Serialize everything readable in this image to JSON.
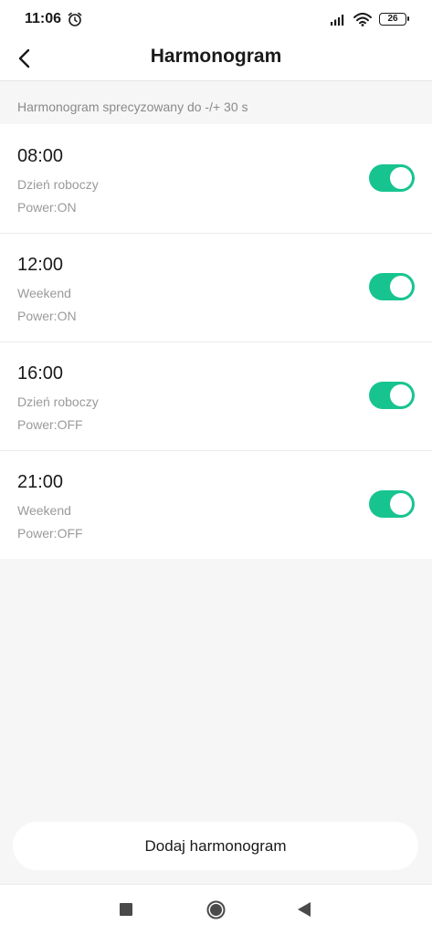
{
  "status": {
    "time": "11:06",
    "battery": "26",
    "icons": [
      "alarm-icon",
      "signal-icon",
      "wifi-icon",
      "battery-icon"
    ]
  },
  "header": {
    "title": "Harmonogram"
  },
  "note": "Harmonogram sprecyzowany do -/+ 30 s",
  "schedules": [
    {
      "time": "08:00",
      "days": "Dzień roboczy",
      "power": "Power:ON",
      "enabled": true
    },
    {
      "time": "12:00",
      "days": "Weekend",
      "power": "Power:ON",
      "enabled": true
    },
    {
      "time": "16:00",
      "days": "Dzień roboczy",
      "power": "Power:OFF",
      "enabled": true
    },
    {
      "time": "21:00",
      "days": "Weekend",
      "power": "Power:OFF",
      "enabled": true
    }
  ],
  "add_button": "Dodaj harmonogram",
  "colors": {
    "toggle_on": "#17c48f",
    "background": "#f6f6f6"
  },
  "nav": {
    "icons": [
      "recent-apps-icon",
      "home-icon",
      "back-icon"
    ]
  }
}
